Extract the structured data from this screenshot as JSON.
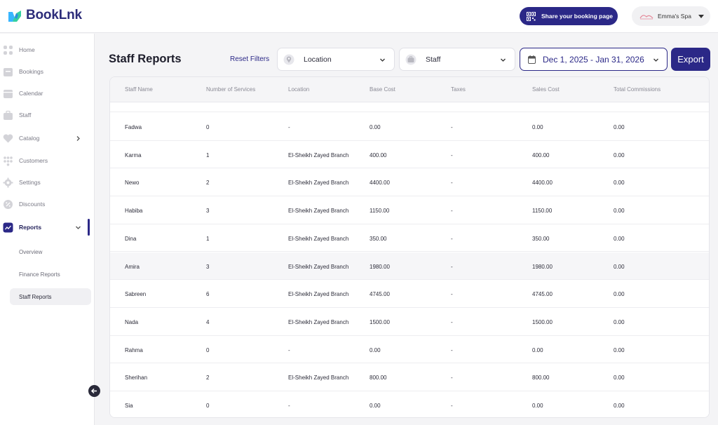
{
  "app": {
    "name": "BookLnk",
    "share_label": "Share your booking page",
    "account_name": "Emma's Spa",
    "colors": {
      "brand": "#2b2887",
      "accent_blue": "#38b6ff",
      "accent_green": "#35d0a0"
    }
  },
  "sidebar": {
    "items": [
      {
        "label": "Home",
        "icon": "home-grid-icon"
      },
      {
        "label": "Bookings",
        "icon": "bookings-icon"
      },
      {
        "label": "Calendar",
        "icon": "calendar-icon"
      },
      {
        "label": "Staff",
        "icon": "briefcase-icon"
      },
      {
        "label": "Catalog",
        "icon": "heart-icon"
      },
      {
        "label": "Customers",
        "icon": "customers-icon"
      },
      {
        "label": "Settings",
        "icon": "gear-icon"
      },
      {
        "label": "Discounts",
        "icon": "discount-icon"
      },
      {
        "label": "Reports",
        "icon": "chart-icon"
      }
    ],
    "reports_sub": [
      "Overview",
      "Finance Reports",
      "Staff Reports"
    ]
  },
  "header": {
    "title": "Staff Reports",
    "reset_label": "Reset Filters",
    "location_placeholder": "Location",
    "staff_placeholder": "Staff",
    "date_range": "Dec 1, 2025 - Jan 31, 2026",
    "export_label": "Export"
  },
  "table": {
    "columns": [
      "Staff Name",
      "Number of Services",
      "Location",
      "Base Cost",
      "Taxes",
      "Sales Cost",
      "Total Commissions"
    ],
    "rows": [
      [
        "Fadwa",
        "0",
        "-",
        "0.00",
        "-",
        "0.00",
        "0.00"
      ],
      [
        "Karma",
        "1",
        "El-Sheikh Zayed Branch",
        "400.00",
        "-",
        "400.00",
        "0.00"
      ],
      [
        "Newo",
        "2",
        "El-Sheikh Zayed Branch",
        "4400.00",
        "-",
        "4400.00",
        "0.00"
      ],
      [
        "Habiba",
        "3",
        "El-Sheikh Zayed Branch",
        "1150.00",
        "-",
        "1150.00",
        "0.00"
      ],
      [
        "Dina",
        "1",
        "El-Sheikh Zayed Branch",
        "350.00",
        "-",
        "350.00",
        "0.00"
      ],
      [
        "Amira",
        "3",
        "El-Sheikh Zayed Branch",
        "1980.00",
        "-",
        "1980.00",
        "0.00"
      ],
      [
        "Sabreen",
        "6",
        "El-Sheikh Zayed Branch",
        "4745.00",
        "-",
        "4745.00",
        "0.00"
      ],
      [
        "Nada",
        "4",
        "El-Sheikh Zayed Branch",
        "1500.00",
        "-",
        "1500.00",
        "0.00"
      ],
      [
        "Rahma",
        "0",
        "-",
        "0.00",
        "-",
        "0.00",
        "0.00"
      ],
      [
        "Sherihan",
        "2",
        "El-Sheikh Zayed Branch",
        "800.00",
        "-",
        "800.00",
        "0.00"
      ],
      [
        "Sia",
        "0",
        "-",
        "0.00",
        "-",
        "0.00",
        "0.00"
      ]
    ]
  }
}
